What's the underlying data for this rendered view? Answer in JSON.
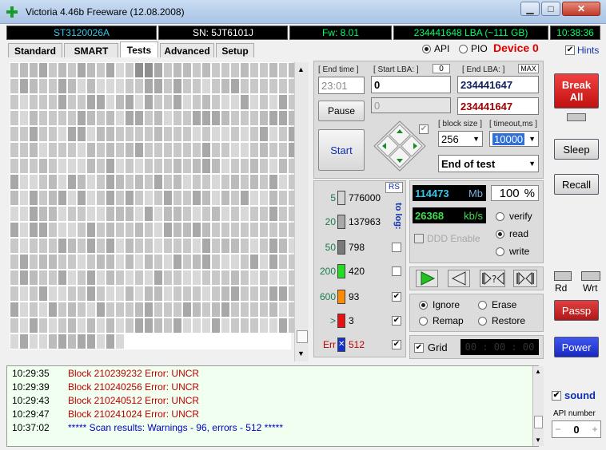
{
  "window": {
    "title": "Victoria 4.46b Freeware (12.08.2008)"
  },
  "info_bar": {
    "model": "ST3120026A",
    "serial": "SN: 5JT6101J",
    "firmware": "Fw: 8.01",
    "lba": "234441648 LBA (~111 GB)",
    "clock": "10:38:36"
  },
  "tabs": [
    "Standard",
    "SMART",
    "Tests",
    "Advanced",
    "Setup"
  ],
  "active_tab": "Tests",
  "mode": {
    "api_label": "API",
    "pio_label": "PIO",
    "device_label": "Device 0",
    "hints_label": "Hints"
  },
  "params": {
    "end_time_label": "[ End time ]",
    "end_time_value": "23:01",
    "start_lba_label": "[ Start LBA: ]",
    "start_lba_zero": "0",
    "start_lba_value": "0",
    "start_lba_value2": "0",
    "end_lba_label": "[ End LBA: ]",
    "max_label": "MAX",
    "end_lba_value": "234441647",
    "end_lba_value2": "234441647",
    "block_size_label": "[ block size ]",
    "block_size_value": "256",
    "timeout_label": "[ timeout,ms ]",
    "timeout_value": "10000",
    "end_action": "End of test"
  },
  "buttons": {
    "pause": "Pause",
    "start": "Start",
    "break_all": "Break All",
    "sleep": "Sleep",
    "recall": "Recall",
    "passp": "Passp",
    "power": "Power",
    "rs": "RS"
  },
  "legend": {
    "to_log": "to log:",
    "rows": [
      {
        "threshold": "5",
        "count": "776000",
        "color": "#d4d4d4"
      },
      {
        "threshold": "20",
        "count": "137963",
        "color": "#a9a9a9"
      },
      {
        "threshold": "50",
        "count": "798",
        "color": "#7a7a7a"
      },
      {
        "threshold": "200",
        "count": "420",
        "color": "#22dd22"
      },
      {
        "threshold": "600",
        "count": "93",
        "color": "#ff8c00"
      },
      {
        "threshold": ">",
        "count": "3",
        "color": "#e81010"
      },
      {
        "threshold": "Err",
        "count": "512",
        "color": "#1030d0"
      }
    ]
  },
  "stats": {
    "mb_value": "114473",
    "mb_unit": "Mb",
    "percent_value": "100",
    "percent_unit": "%",
    "speed_value": "26368",
    "speed_unit": "kb/s",
    "ddd_label": "DDD Enable"
  },
  "test_mode": {
    "verify": "verify",
    "read": "read",
    "write": "write",
    "selected": "read"
  },
  "action_mode": {
    "ignore": "Ignore",
    "erase": "Erase",
    "remap": "Remap",
    "restore": "Restore",
    "selected": "Ignore"
  },
  "grid_label": "Grid",
  "timer": "00 : 00 : 00",
  "indicators": {
    "rd": "Rd",
    "wrt": "Wrt"
  },
  "sound_label": "sound",
  "api_number_label": "API number",
  "api_number_value": "0",
  "log": [
    {
      "time": "10:29:35",
      "text": "Block 210239232 Error: UNCR",
      "type": "error"
    },
    {
      "time": "10:29:39",
      "text": "Block 210240256 Error: UNCR",
      "type": "error"
    },
    {
      "time": "10:29:43",
      "text": "Block 210240512 Error: UNCR",
      "type": "error"
    },
    {
      "time": "10:29:47",
      "text": "Block 210241024 Error: UNCR",
      "type": "error"
    },
    {
      "time": "10:37:02",
      "text": "***** Scan results: Warnings - 96, errors - 512 *****",
      "type": "result"
    }
  ],
  "colors": {
    "error_text": "#c00000",
    "result_text": "#0000c0",
    "break_button": "#e01818",
    "passp_button": "#c82020",
    "power_button": "#2030d0",
    "info_text": "#00ff66"
  }
}
